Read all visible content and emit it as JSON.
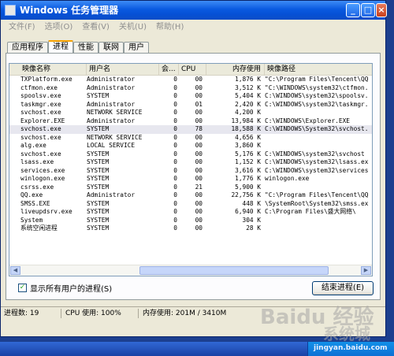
{
  "window": {
    "title": "Windows 任务管理器",
    "buttons": {
      "minimize": "_",
      "maximize": "□",
      "close": "×"
    }
  },
  "menu": [
    "文件(F)",
    "选项(O)",
    "查看(V)",
    "关机(U)",
    "帮助(H)"
  ],
  "tabs": [
    {
      "label": "应用程序",
      "active": false
    },
    {
      "label": "进程",
      "active": true
    },
    {
      "label": "性能",
      "active": false
    },
    {
      "label": "联网",
      "active": false
    },
    {
      "label": "用户",
      "active": false
    }
  ],
  "columns": [
    "映像名称",
    "用户名",
    "会...",
    "CPU",
    "内存使用",
    "映像路径"
  ],
  "processes": [
    {
      "name": "TXPlatform.exe",
      "user": "Administrator",
      "session": "0",
      "cpu": "00",
      "mem": "1,876 K",
      "path": "\"C:\\Program Files\\Tencent\\QQ"
    },
    {
      "name": "ctfmon.exe",
      "user": "Administrator",
      "session": "0",
      "cpu": "00",
      "mem": "3,512 K",
      "path": "\"C:\\WINDOWS\\system32\\ctfmon."
    },
    {
      "name": "spoolsv.exe",
      "user": "SYSTEM",
      "session": "0",
      "cpu": "00",
      "mem": "5,404 K",
      "path": "C:\\WINDOWS\\system32\\spoolsv."
    },
    {
      "name": "taskmgr.exe",
      "user": "Administrator",
      "session": "0",
      "cpu": "01",
      "mem": "2,420 K",
      "path": "C:\\WINDOWS\\system32\\taskmgr."
    },
    {
      "name": "svchost.exe",
      "user": "NETWORK SERVICE",
      "session": "0",
      "cpu": "00",
      "mem": "4,200 K",
      "path": ""
    },
    {
      "name": "Explorer.EXE",
      "user": "Administrator",
      "session": "0",
      "cpu": "00",
      "mem": "13,984 K",
      "path": "C:\\WINDOWS\\Explorer.EXE"
    },
    {
      "name": "svchost.exe",
      "user": "SYSTEM",
      "session": "0",
      "cpu": "78",
      "mem": "18,588 K",
      "path": "C:\\WINDOWS\\System32\\svchost."
    },
    {
      "name": "svchost.exe",
      "user": "NETWORK SERVICE",
      "session": "0",
      "cpu": "00",
      "mem": "4,656 K",
      "path": ""
    },
    {
      "name": "alg.exe",
      "user": "LOCAL SERVICE",
      "session": "0",
      "cpu": "00",
      "mem": "3,860 K",
      "path": ""
    },
    {
      "name": "svchost.exe",
      "user": "SYSTEM",
      "session": "0",
      "cpu": "00",
      "mem": "5,176 K",
      "path": "C:\\WINDOWS\\system32\\svchost"
    },
    {
      "name": "lsass.exe",
      "user": "SYSTEM",
      "session": "0",
      "cpu": "00",
      "mem": "1,152 K",
      "path": "C:\\WINDOWS\\system32\\lsass.ex"
    },
    {
      "name": "services.exe",
      "user": "SYSTEM",
      "session": "0",
      "cpu": "00",
      "mem": "3,616 K",
      "path": "C:\\WINDOWS\\system32\\services"
    },
    {
      "name": "winlogon.exe",
      "user": "SYSTEM",
      "session": "0",
      "cpu": "00",
      "mem": "1,776 K",
      "path": "winlogon.exe"
    },
    {
      "name": "csrss.exe",
      "user": "SYSTEM",
      "session": "0",
      "cpu": "21",
      "mem": "5,900 K",
      "path": ""
    },
    {
      "name": "QQ.exe",
      "user": "Administrator",
      "session": "0",
      "cpu": "00",
      "mem": "22,756 K",
      "path": "\"C:\\Program Files\\Tencent\\QQ"
    },
    {
      "name": "SMSS.EXE",
      "user": "SYSTEM",
      "session": "0",
      "cpu": "00",
      "mem": "448 K",
      "path": "\\SystemRoot\\System32\\smss.ex"
    },
    {
      "name": "liveupdsrv.exe",
      "user": "SYSTEM",
      "session": "0",
      "cpu": "00",
      "mem": "6,940 K",
      "path": "C:\\Program Files\\盛大网络\\"
    },
    {
      "name": "System",
      "user": "SYSTEM",
      "session": "0",
      "cpu": "00",
      "mem": "304 K",
      "path": ""
    },
    {
      "name": "系统空闲进程",
      "user": "SYSTEM",
      "session": "0",
      "cpu": "00",
      "mem": "28 K",
      "path": ""
    }
  ],
  "show_all_users": {
    "label": "显示所有用户的进程(S)",
    "checked": true
  },
  "end_process_label": "结束进程(E)",
  "status": {
    "processes": "进程数: 19",
    "cpu": "CPU 使用: 100%",
    "memory": "内存使用: 201M / 3410M"
  },
  "watermark": {
    "line1": "Baidu 经验",
    "line2": "系统城"
  },
  "tray_text": "jingyan.baidu.com"
}
